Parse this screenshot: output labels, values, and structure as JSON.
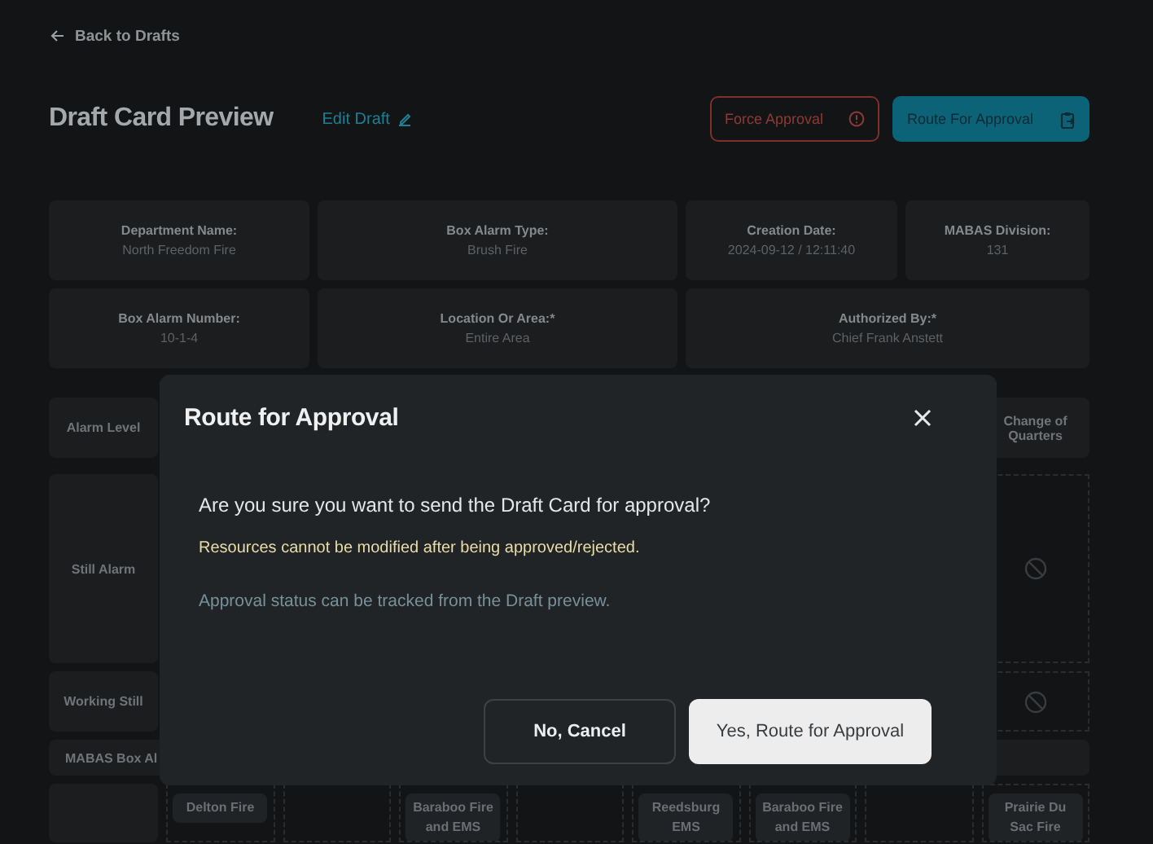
{
  "back_link": {
    "label": "Back to Drafts"
  },
  "header": {
    "title": "Draft Card Preview",
    "edit_link": "Edit Draft",
    "actions": [
      {
        "label": "Force Approval",
        "kind": "danger"
      },
      {
        "label": "Route For Approval",
        "kind": "primary"
      }
    ]
  },
  "info_rows": [
    [
      {
        "label": "Department Name:",
        "value": "North Freedom Fire"
      },
      {
        "label": "Box Alarm Type:",
        "value": "Brush Fire"
      },
      {
        "label": "Creation Date:",
        "value": "2024-09-12 / 12:11:40"
      },
      {
        "label": "MABAS Division:",
        "value": "131"
      }
    ],
    [
      {
        "label": "Box Alarm Number:",
        "value": "10-1-4"
      },
      {
        "label": "Location Or Area:*",
        "value": "Entire Area"
      },
      {
        "label": "Authorized By:*",
        "value": "Chief Frank Anstett"
      }
    ]
  ],
  "card_grid": {
    "corner": "Alarm Level",
    "last_column": "Change of Quarters",
    "rows": [
      {
        "kind": "level",
        "label": "Still Alarm",
        "cells": [
          {
            "kind": "empty"
          },
          {
            "kind": "empty"
          },
          {
            "kind": "empty"
          },
          {
            "kind": "empty"
          },
          {
            "kind": "empty"
          },
          {
            "kind": "empty"
          },
          {
            "kind": "empty"
          },
          {
            "kind": "blocked"
          }
        ]
      },
      {
        "kind": "level",
        "label": "Working Still",
        "cells": [
          {
            "kind": "empty"
          },
          {
            "kind": "empty"
          },
          {
            "kind": "empty"
          },
          {
            "kind": "empty"
          },
          {
            "kind": "empty"
          },
          {
            "kind": "empty"
          },
          {
            "kind": "empty"
          },
          {
            "kind": "blocked"
          }
        ]
      },
      {
        "kind": "section",
        "label": "MABAS Box Al"
      },
      {
        "kind": "units",
        "label": "",
        "cells": [
          {
            "kind": "units",
            "units": [
              "Delton Fire"
            ]
          },
          {
            "kind": "empty"
          },
          {
            "kind": "units",
            "units": [
              "Baraboo Fire and EMS"
            ]
          },
          {
            "kind": "empty"
          },
          {
            "kind": "units",
            "units": [
              "Reedsburg EMS"
            ]
          },
          {
            "kind": "units",
            "units": [
              "Baraboo Fire and EMS"
            ]
          },
          {
            "kind": "empty"
          },
          {
            "kind": "units",
            "units": [
              "Prairie Du Sac Fire"
            ]
          }
        ]
      }
    ]
  },
  "dialog": {
    "title": "Route for Approval",
    "question": "Are you sure you want to send the Draft Card for approval?",
    "warning": "Resources cannot be modified after being approved/rejected.",
    "note": "Approval status can be tracked from the Draft preview.",
    "buttons": [
      {
        "label": "No, Cancel",
        "kind": "secondary"
      },
      {
        "label": "Yes, Route for Approval",
        "kind": "confirm"
      }
    ]
  }
}
